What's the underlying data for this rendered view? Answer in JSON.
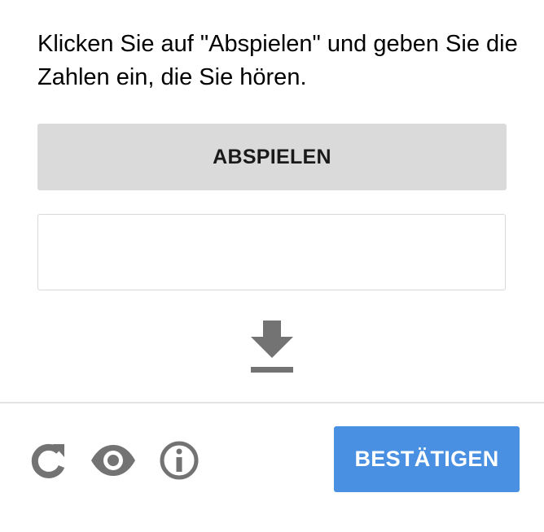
{
  "challenge": {
    "instructions": "Klicken Sie auf \"Abspielen\" und geben Sie die Zahlen ein, die Sie hören.",
    "play_label": "ABSPIELEN",
    "response_value": "",
    "response_placeholder": "",
    "download_icon": "download-icon"
  },
  "footer": {
    "icons": {
      "reload": "reload-icon",
      "visual_challenge": "eye-icon",
      "info": "info-icon"
    },
    "verify_label": "BESTÄTIGEN"
  },
  "colors": {
    "play_button_bg": "#dadada",
    "verify_button_bg": "#4a90e2",
    "icon_gray": "#737373",
    "divider": "#e3e3e3"
  }
}
